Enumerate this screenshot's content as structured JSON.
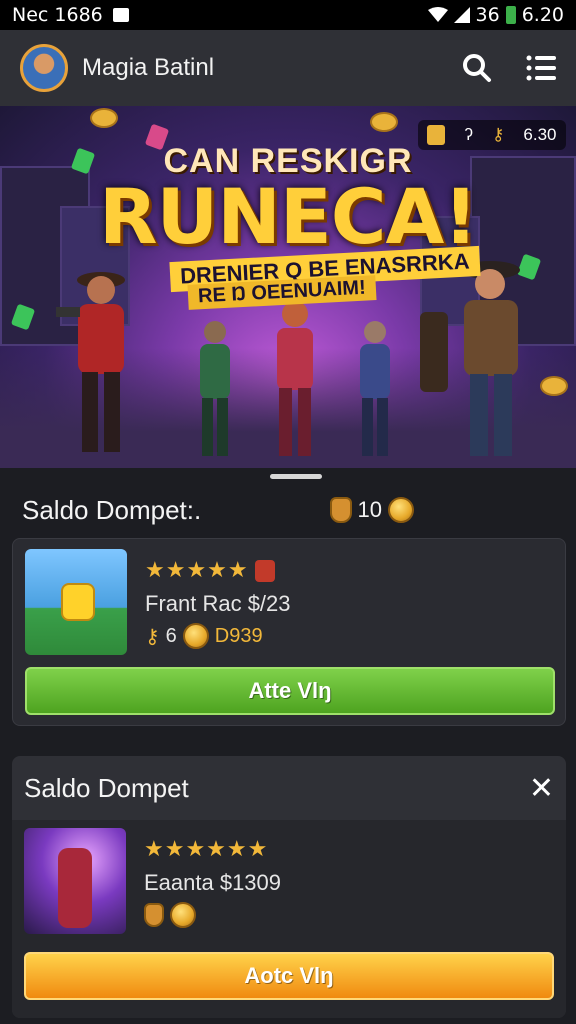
{
  "status": {
    "time": "Nec 1686",
    "signal": "36",
    "battery": "6.20"
  },
  "appbar": {
    "title": "Magia Batinl",
    "search_icon": "search-icon",
    "menu_icon": "menu-icon"
  },
  "hero": {
    "line1": "CAN RESKIGR",
    "line2": "RUNECA!",
    "line3": "DRENIER Q BE ENASRRKA",
    "line4": "RE Ŋ OEENUAIM!",
    "hud_left": "ʔ",
    "hud_right": "6.30"
  },
  "balance": {
    "label": "Saldo Dompet:.",
    "value": "10"
  },
  "card1": {
    "stars": "★★★★★",
    "name": "Frant Rac $/23",
    "count": "6",
    "price": "D939",
    "button": "Atte Vlŋ"
  },
  "section2": {
    "title": "Saldo Dompet",
    "close_label": "✕",
    "stars": "★★★★★★",
    "name": "Eaanta $1309",
    "button": "Aotc Vlŋ"
  },
  "colors": {
    "accent_gold": "#f2b83a",
    "green_btn": "#5eb52a",
    "orange_btn": "#f5a523",
    "bar": "#2f3036"
  }
}
